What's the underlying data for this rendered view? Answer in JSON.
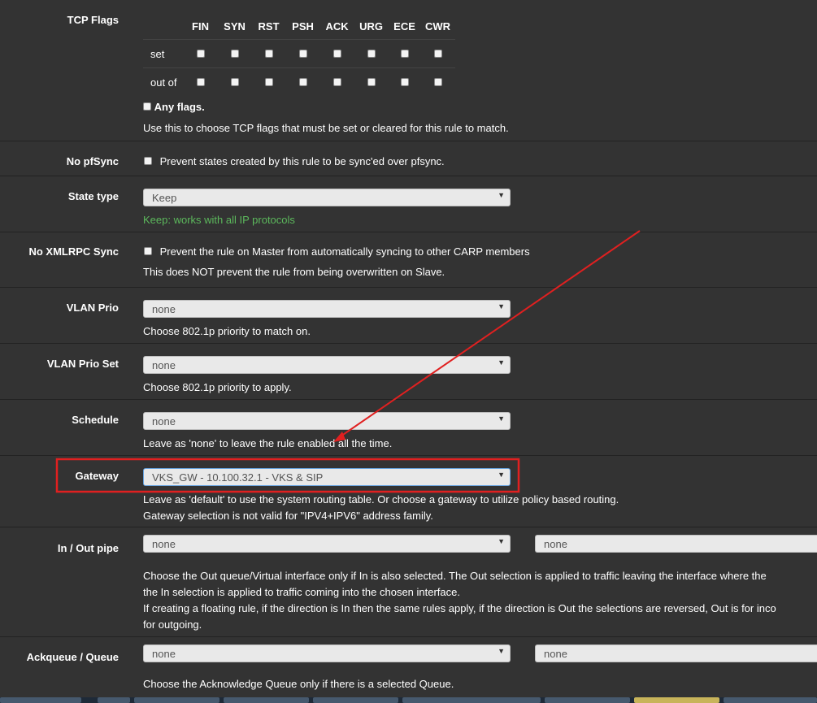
{
  "tcp_flags": {
    "label": "TCP Flags",
    "columns": [
      "FIN",
      "SYN",
      "RST",
      "PSH",
      "ACK",
      "URG",
      "ECE",
      "CWR"
    ],
    "row_set": "set",
    "row_out_of": "out of",
    "any_flags": "Any flags.",
    "help": "Use this to choose TCP flags that must be set or cleared for this rule to match."
  },
  "no_pfsync": {
    "label": "No pfSync",
    "checkbox_text": "Prevent states created by this rule to be sync'ed over pfsync."
  },
  "state_type": {
    "label": "State type",
    "value": "Keep",
    "help": "Keep: works with all IP protocols"
  },
  "no_xmlrpc": {
    "label": "No XMLRPC Sync",
    "checkbox_text": "Prevent the rule on Master from automatically syncing to other CARP members",
    "help": "This does NOT prevent the rule from being overwritten on Slave."
  },
  "vlan_prio": {
    "label": "VLAN Prio",
    "value": "none",
    "help": "Choose 802.1p priority to match on."
  },
  "vlan_prio_set": {
    "label": "VLAN Prio Set",
    "value": "none",
    "help": "Choose 802.1p priority to apply."
  },
  "schedule": {
    "label": "Schedule",
    "value": "none",
    "help": "Leave as 'none' to leave the rule enabled all the time."
  },
  "gateway": {
    "label": "Gateway",
    "value": "VKS_GW - 10.100.32.1 - VKS & SIP",
    "help1": "Leave as 'default' to use the system routing table. Or choose a gateway to utilize policy based routing.",
    "help2": "Gateway selection is not valid for \"IPV4+IPV6\" address family."
  },
  "in_out_pipe": {
    "label": "In / Out pipe",
    "in_value": "none",
    "out_value": "none",
    "help1": "Choose the Out queue/Virtual interface only if In is also selected. The Out selection is applied to traffic leaving the interface where the",
    "help2": "the In selection is applied to traffic coming into the chosen interface.",
    "help3": "If creating a floating rule, if the direction is In then the same rules apply, if the direction is Out the selections are reversed, Out is for inco",
    "help4": "for outgoing."
  },
  "ackqueue": {
    "label": "Ackqueue / Queue",
    "ack_value": "none",
    "queue_value": "none",
    "help": "Choose the Acknowledge Queue only if there is a selected Queue."
  },
  "colors": {
    "background": "#333333",
    "help_green": "#5cb85c",
    "annotation_red": "#e02020"
  }
}
